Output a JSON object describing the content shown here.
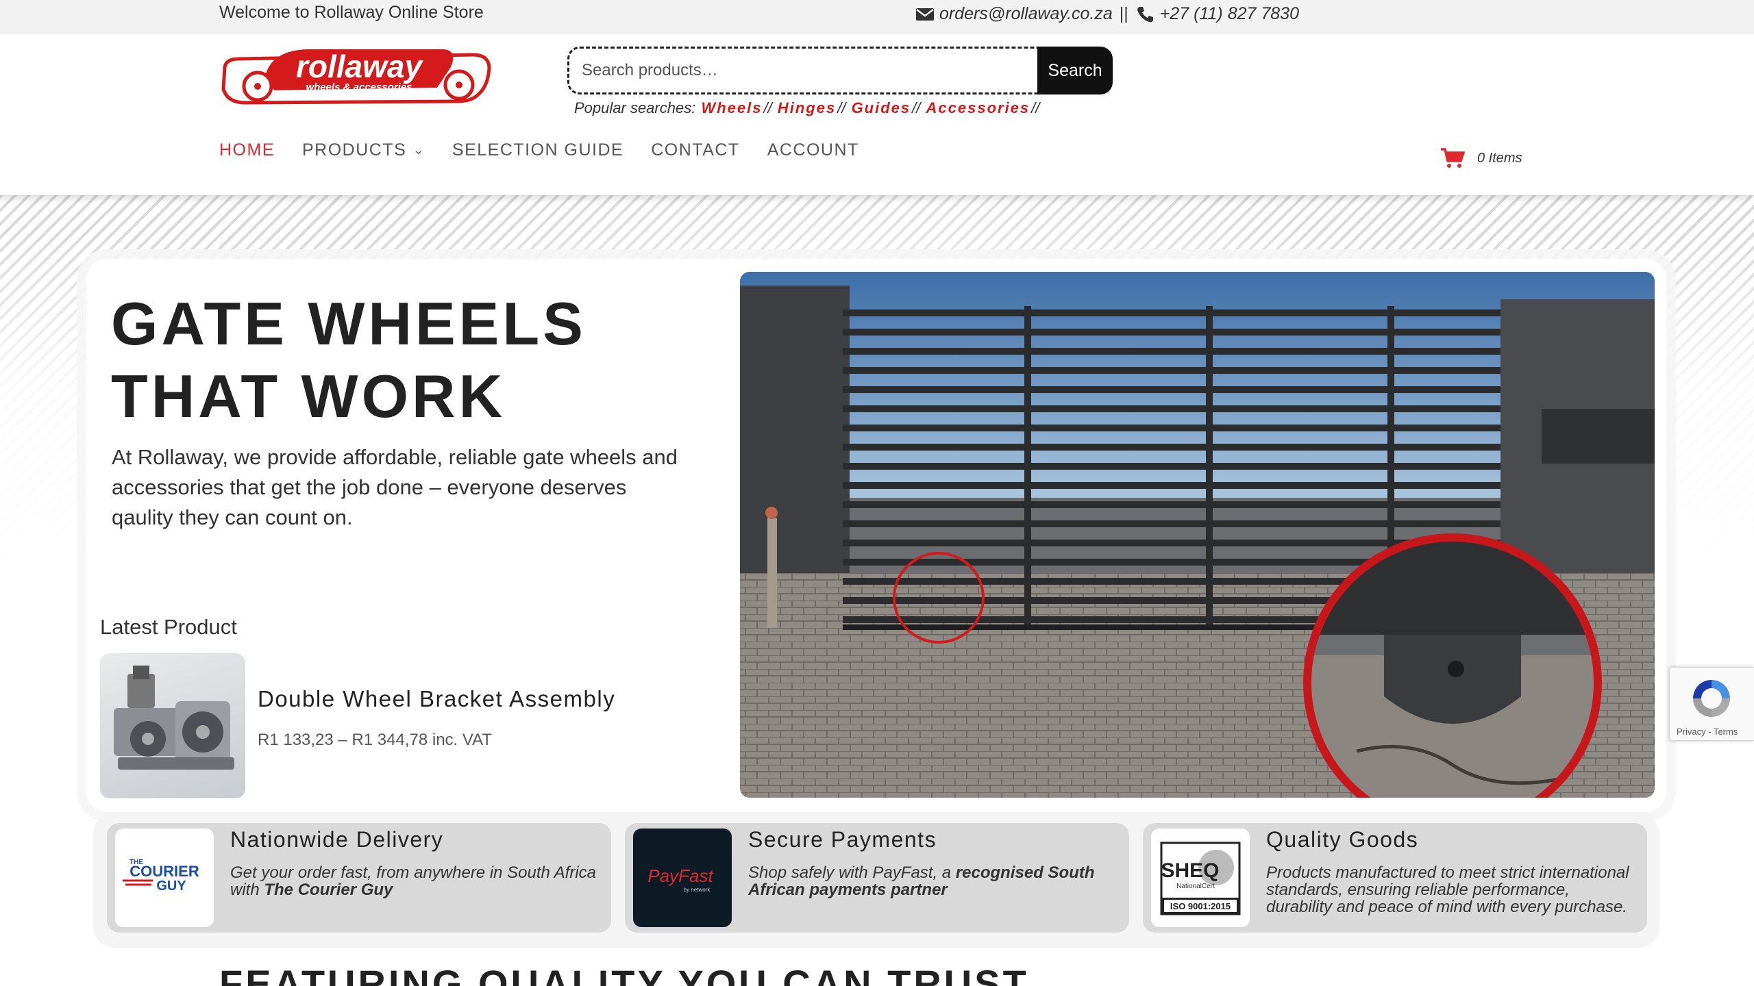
{
  "topbar": {
    "welcome": "Welcome to Rollaway Online Store",
    "email": "orders@rollaway.co.za",
    "separator": "||",
    "phone": "+27 (11) 827 7830"
  },
  "logo": {
    "name": "rollaway",
    "tagline": "wheels & accessories"
  },
  "search": {
    "placeholder": "Search products…",
    "button": "Search",
    "popular_label": "Popular searches:",
    "popular": [
      "Wheels",
      "Hinges",
      "Guides",
      "Accessories"
    ],
    "popular_sep": "//"
  },
  "nav": {
    "home": "HOME",
    "products": "PRODUCTS",
    "selection_guide": "SELECTION GUIDE",
    "contact": "CONTACT",
    "account": "ACCOUNT"
  },
  "cart": {
    "label": "0 Items"
  },
  "hero": {
    "title_line1": "GATE WHEELS",
    "title_line2": "THAT WORK",
    "text": "At Rollaway, we provide affordable, reliable gate wheels and accessories that get the job done – everyone deserves qaulity they can count on."
  },
  "latest": {
    "label": "Latest Product",
    "product_name": "Double Wheel Bracket Assembly",
    "price": "R1 133,23 – R1 344,78 inc. VAT"
  },
  "features": [
    {
      "title": "Nationwide Delivery",
      "text_plain": "Get your order fast, from anywhere in South Africa with ",
      "text_bold": "The Courier Guy",
      "logo_the": "THE",
      "logo_text1": "COURIER",
      "logo_text2": "GUY"
    },
    {
      "title": "Secure Payments",
      "text_plain": "Shop safely with PayFast, a ",
      "text_bold": "recognised South African payments partner",
      "logo_text": "PayFast",
      "logo_sub": "by network"
    },
    {
      "title": "Quality Goods",
      "text_plain": "Products manufactured to meet strict international standards, ensuring reliable performance, durability and peace of mind with every purchase.",
      "text_bold": "",
      "logo_text": "SHEQ",
      "logo_sub": "NationalCert",
      "logo_iso": "ISO 9001:2015"
    }
  ],
  "bottom_heading": "FEATURING QUALITY YOU CAN TRUST",
  "recaptcha": {
    "text": "Privacy - Terms"
  },
  "colors": {
    "accent": "#e0282e",
    "brand_red": "#d41a1a",
    "dark": "#111111",
    "feature_bg": "#d9d9d9"
  }
}
